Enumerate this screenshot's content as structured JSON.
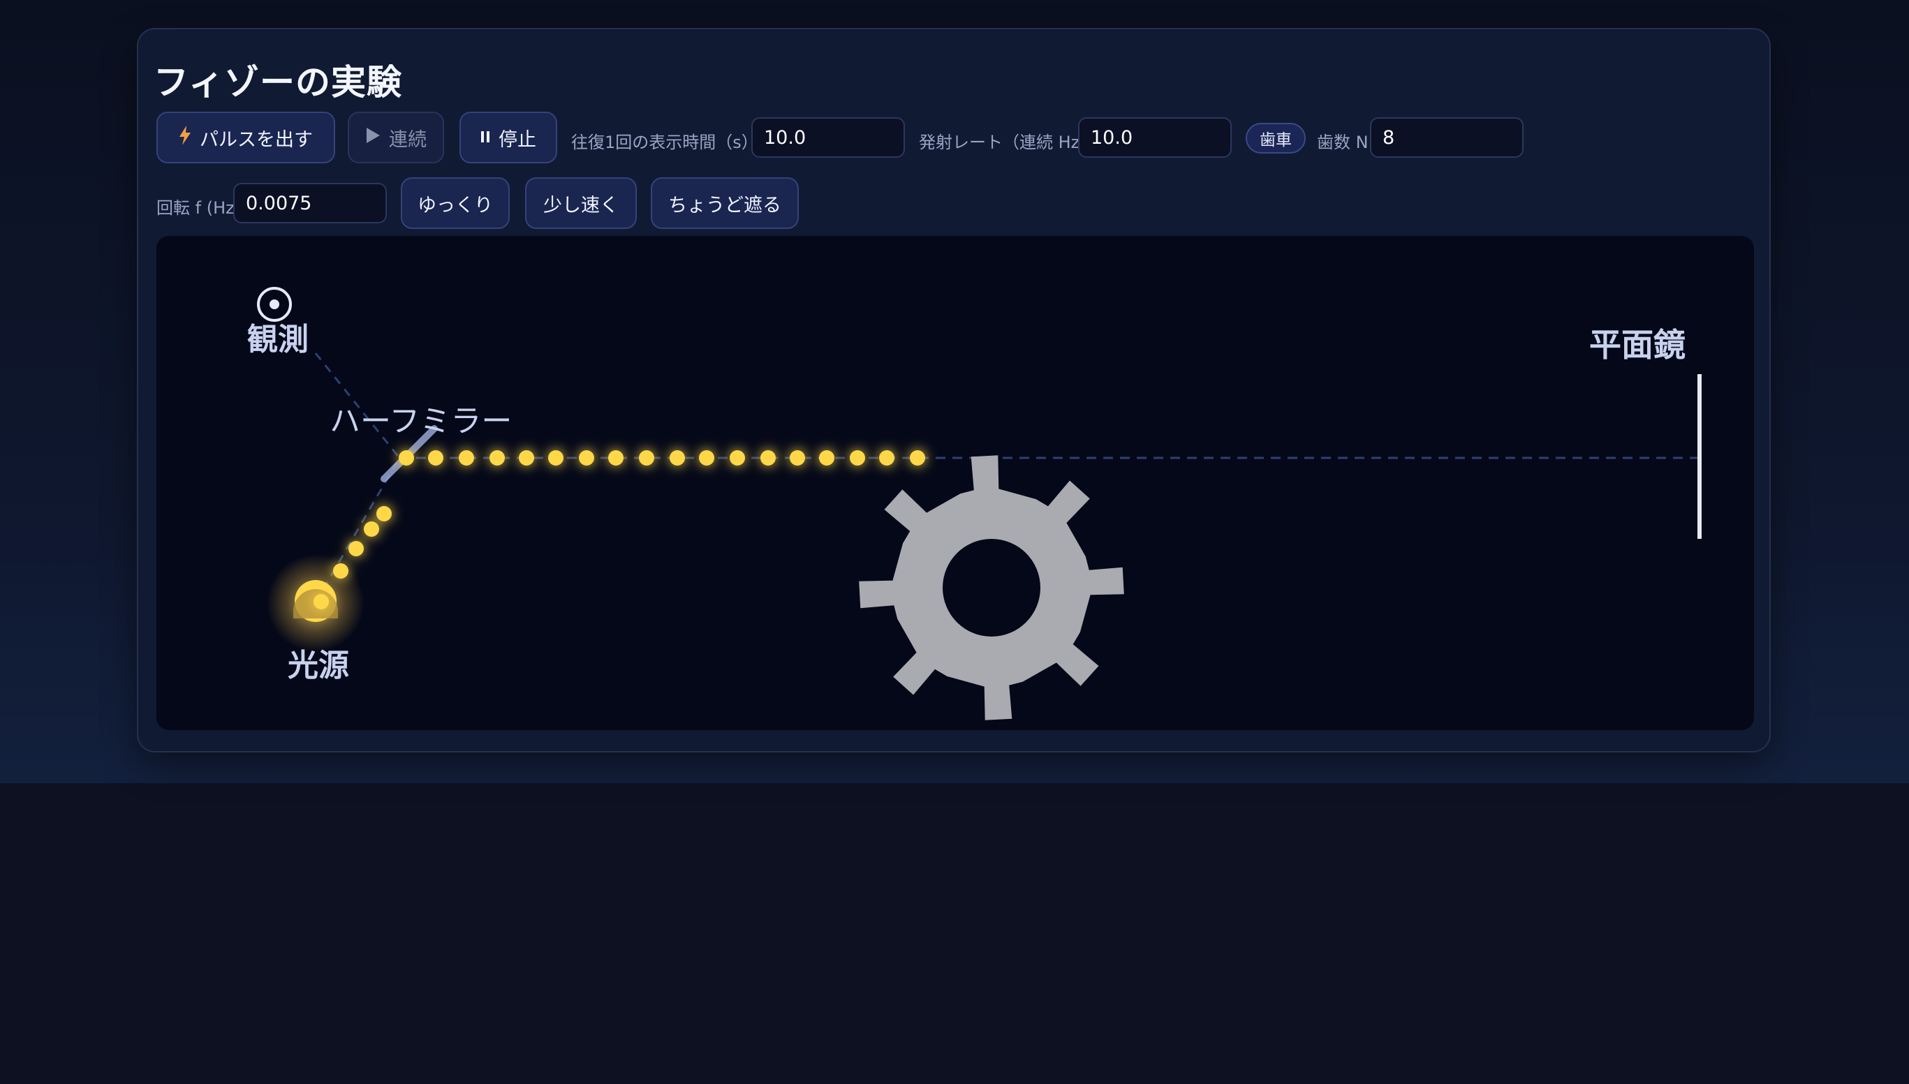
{
  "app": {
    "title": "フィゾーの実験"
  },
  "toolbar": {
    "pulse_label": "パルスを出す",
    "continuous_label": "連続",
    "stop_label": "停止",
    "roundtrip_label": "往復1回の表示時間（s）",
    "roundtrip_value": "10.0",
    "rate_label": "発射レート（連続 Hz）",
    "rate_value": "10.0",
    "gear_badge": "歯車",
    "teeth_label": "歯数 N",
    "teeth_value": "8",
    "rotation_label": "回転 f (Hz)",
    "rotation_value": "0.0075",
    "slow_label": "ゆっくり",
    "faster_label": "少し速く",
    "block_label": "ちょうど遮る"
  },
  "icons": {
    "pulse": "lightning-icon",
    "continuous": "play-icon",
    "stop": "pause-icon",
    "observer": "eye-target-icon"
  },
  "scene": {
    "observer_label": "観測",
    "half_mirror_label": "ハーフミラー",
    "mirror_label": "平面鏡",
    "source_label": "光源",
    "gear_teeth": 8
  },
  "colors": {
    "accent": "#f59e42",
    "pulse": "#ffd84a",
    "gear": "#a9abb0",
    "beam_path": "#3a4f8a"
  }
}
